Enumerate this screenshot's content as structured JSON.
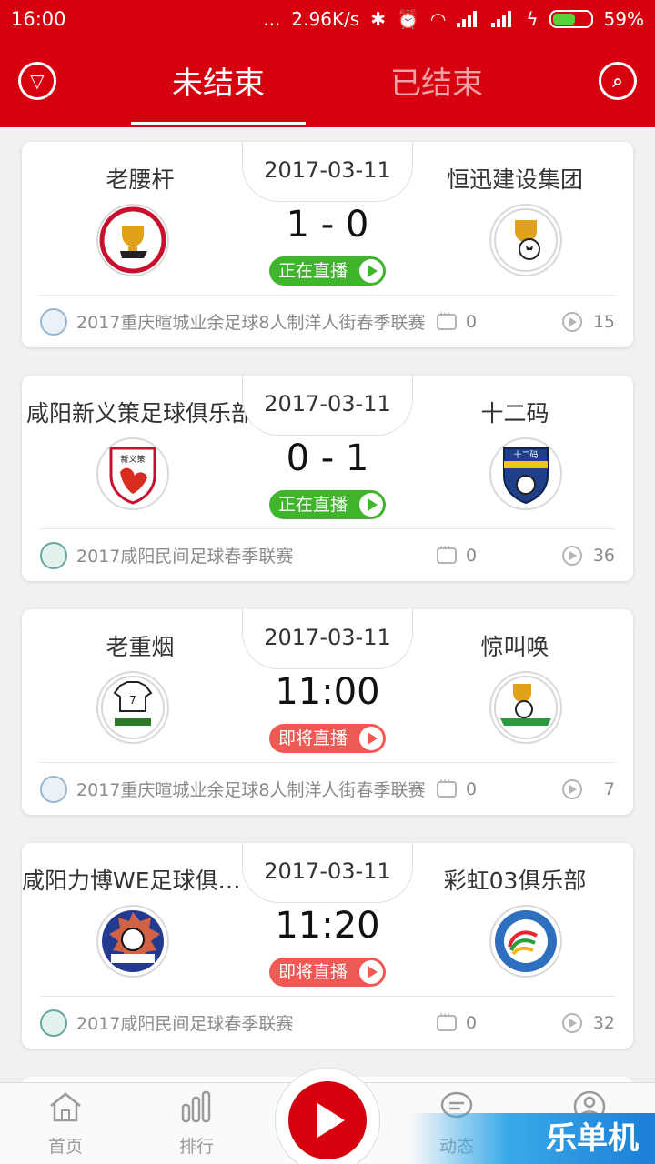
{
  "status_bar": {
    "time": "16:00",
    "dots": "...",
    "network_speed": "2.96K/s",
    "battery": "59%"
  },
  "header": {
    "tabs": [
      {
        "label": "未结束"
      },
      {
        "label": "已结束"
      }
    ]
  },
  "matches": [
    {
      "date": "2017-03-11",
      "home": "老腰杆",
      "away": "恒迅建设集团",
      "score": "1 - 0",
      "status": "正在直播",
      "status_type": "on",
      "league": "2017重庆暄城业余足球8人制洋人街春季联赛",
      "comments": "0",
      "views": "15"
    },
    {
      "date": "2017-03-11",
      "home": "咸阳新义策足球俱乐部",
      "away": "十二码",
      "score": "0 - 1",
      "status": "正在直播",
      "status_type": "on",
      "league": "2017咸阳民间足球春季联赛",
      "comments": "0",
      "views": "36"
    },
    {
      "date": "2017-03-11",
      "home": "老重烟",
      "away": "惊叫唤",
      "score": "11:00",
      "status": "即将直播",
      "status_type": "soon",
      "league": "2017重庆暄城业余足球8人制洋人街春季联赛",
      "comments": "0",
      "views": "7"
    },
    {
      "date": "2017-03-11",
      "home": "咸阳力博WE足球俱乐部",
      "away": "彩虹03俱乐部",
      "score": "11:20",
      "status": "即将直播",
      "status_type": "soon",
      "league": "2017咸阳民间足球春季联赛",
      "comments": "0",
      "views": "32"
    }
  ],
  "bottom_nav": {
    "home": "首页",
    "rank": "排行",
    "feed": "动态"
  },
  "watermark": "乐单机",
  "colors": {
    "brand": "#d7000f",
    "live": "#3fb52b",
    "upcoming": "#ef5a55"
  }
}
